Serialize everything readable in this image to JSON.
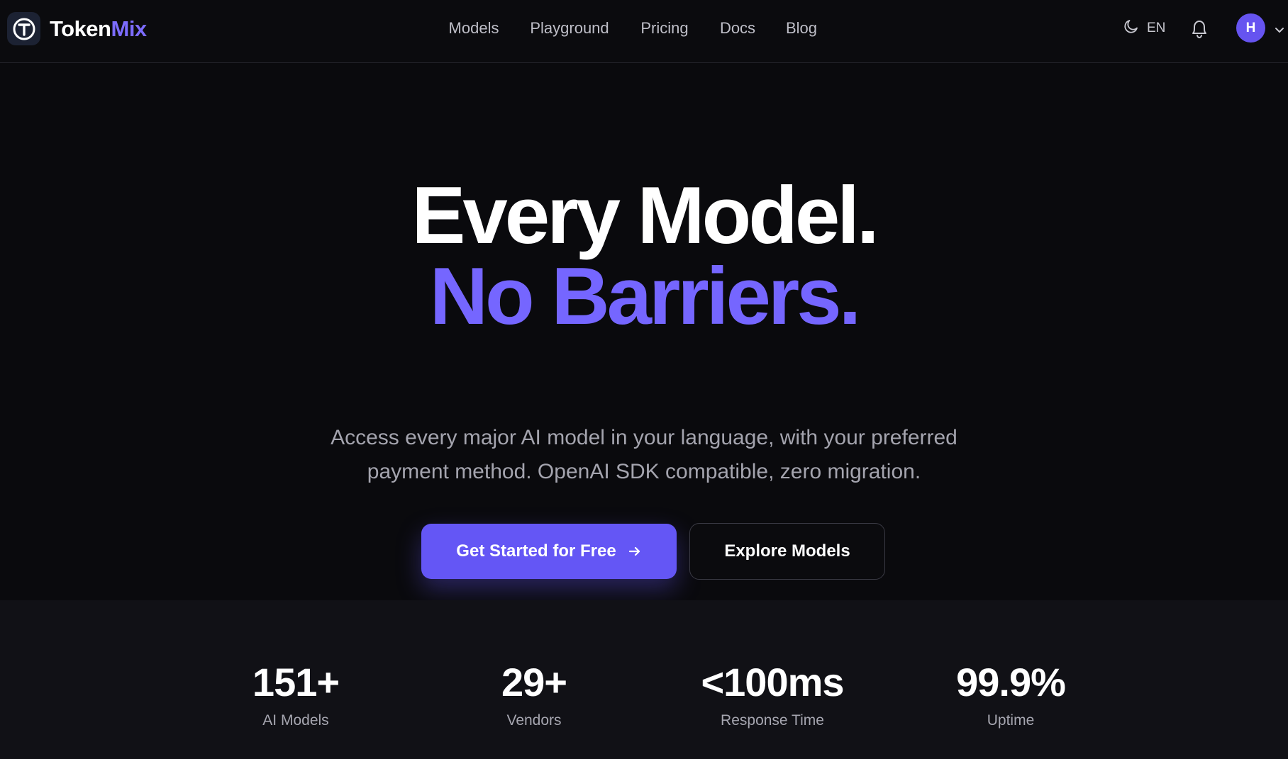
{
  "brand": {
    "name_part1": "Token",
    "name_part2": "Mix",
    "accent": "#7c6cff"
  },
  "nav": {
    "items": [
      {
        "label": "Models"
      },
      {
        "label": "Playground"
      },
      {
        "label": "Pricing"
      },
      {
        "label": "Docs"
      },
      {
        "label": "Blog"
      }
    ]
  },
  "header_right": {
    "theme_icon": "moon-icon",
    "language": "EN",
    "notification_icon": "bell-icon",
    "avatar_initial": "H",
    "avatar_color": "#6654f0",
    "caret_icon": "chevron-down-icon"
  },
  "hero": {
    "headline_line1": "Every Model.",
    "headline_line2": "No Barriers.",
    "headline_line2_color": "#7566ff",
    "subtitle_line1": "Access every major AI model in your language, with your preferred",
    "subtitle_line2": "payment method. OpenAI SDK compatible, zero migration.",
    "primary_cta": "Get Started for Free",
    "primary_cta_icon": "arrow-right-icon",
    "secondary_cta": "Explore Models"
  },
  "stats": [
    {
      "value": "151+",
      "label": "AI Models"
    },
    {
      "value": "29+",
      "label": "Vendors"
    },
    {
      "value": "<100ms",
      "label": "Response Time"
    },
    {
      "value": "99.9%",
      "label": "Uptime"
    }
  ]
}
